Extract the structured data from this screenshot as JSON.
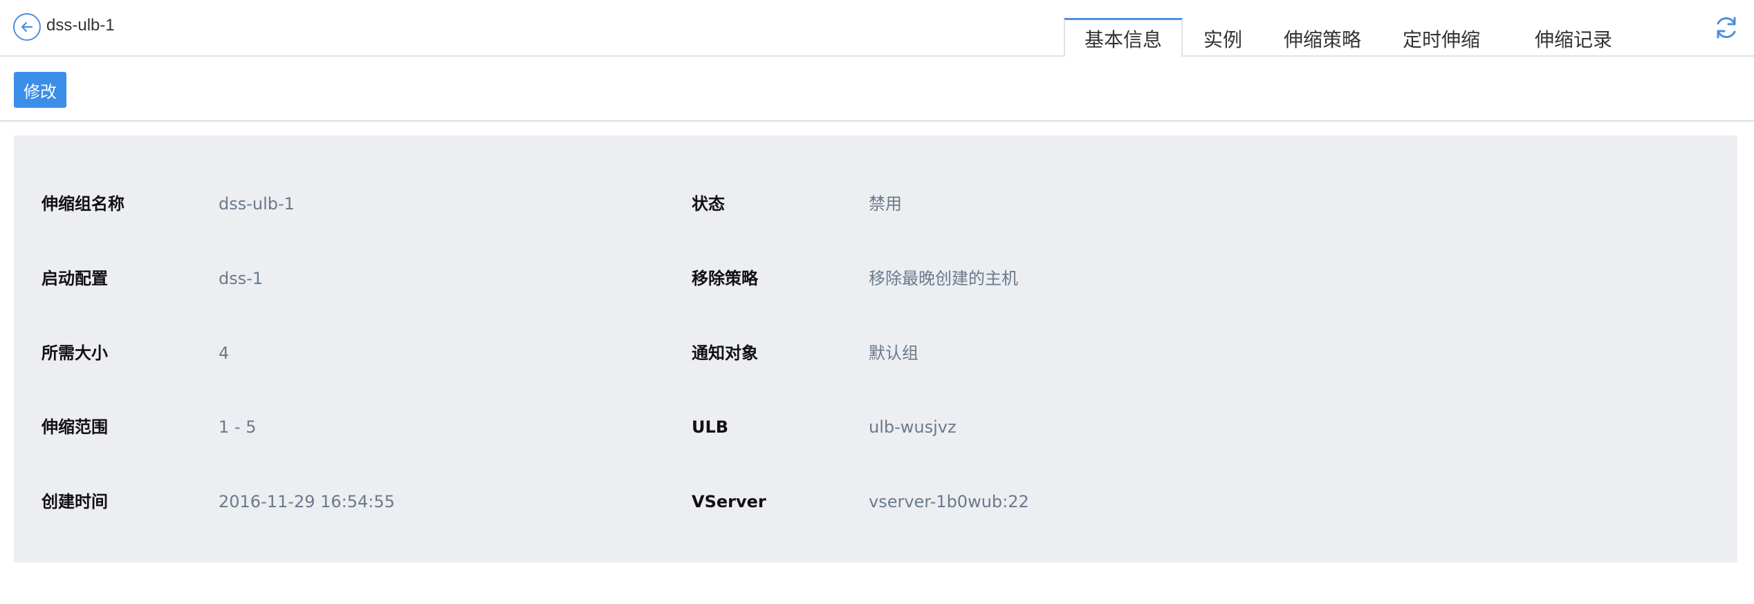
{
  "header": {
    "title": "dss-ulb-1",
    "tabs": [
      {
        "label": "基本信息",
        "active": true
      },
      {
        "label": "实例",
        "active": false
      },
      {
        "label": "伸缩策略",
        "active": false
      },
      {
        "label": "定时伸缩",
        "active": false
      },
      {
        "label": "伸缩记录",
        "active": false
      }
    ],
    "icons": {
      "back": "back-arrow-icon",
      "refresh": "refresh-icon"
    }
  },
  "toolbar": {
    "edit_label": "修改"
  },
  "details": {
    "left": [
      {
        "label": "伸缩组名称",
        "value": "dss-ulb-1"
      },
      {
        "label": "启动配置",
        "value": "dss-1"
      },
      {
        "label": "所需大小",
        "value": "4"
      },
      {
        "label": "伸缩范围",
        "value": "1 - 5"
      },
      {
        "label": "创建时间",
        "value": "2016-11-29 16:54:55"
      }
    ],
    "right": [
      {
        "label": "状态",
        "value": "禁用"
      },
      {
        "label": "移除策略",
        "value": "移除最晚创建的主机"
      },
      {
        "label": "通知对象",
        "value": "默认组"
      },
      {
        "label": "ULB",
        "value": "ulb-wusjvz"
      },
      {
        "label": "VServer",
        "value": "vserver-1b0wub:22"
      }
    ]
  },
  "colors": {
    "accent": "#3b8fe8",
    "panel_bg": "#eceef2",
    "value_text": "#6b7a8c"
  }
}
